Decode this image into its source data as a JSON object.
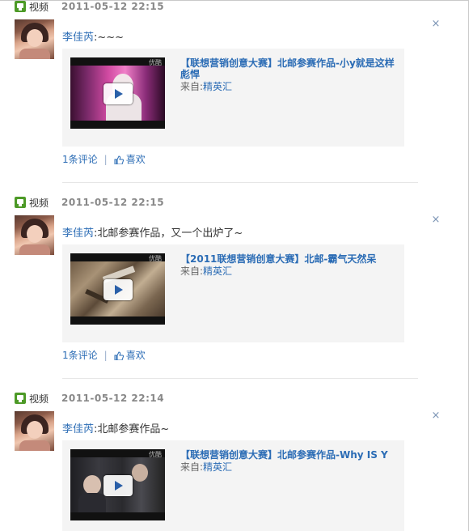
{
  "posts": [
    {
      "type_label": "视频",
      "timestamp": "2011-05-12 22:15",
      "close": "×",
      "author": "李佳芮",
      "message": ":~~~",
      "video": {
        "title": "【联想营销创意大赛】北邮参赛作品-小y就是这样彪悍",
        "source_prefix": "来自:",
        "source_name": "精英汇",
        "logo": "优酷"
      },
      "comments": "1条评论",
      "separator": "|",
      "like": "喜欢"
    },
    {
      "type_label": "视频",
      "timestamp": "2011-05-12 22:15",
      "close": "×",
      "author": "李佳芮",
      "message": ":北邮参赛作品，又一个出炉了~",
      "video": {
        "title": "【2011联想营销创意大赛】北邮-霸气天然呆",
        "source_prefix": "来自:",
        "source_name": "精英汇",
        "logo": "优酷"
      },
      "comments": "1条评论",
      "separator": "|",
      "like": "喜欢"
    },
    {
      "type_label": "视频",
      "timestamp": "2011-05-12 22:14",
      "close": "×",
      "author": "李佳芮",
      "message": ":北邮参赛作品~",
      "video": {
        "title": "【联想营销创意大赛】北邮参赛作品-Why IS Y",
        "source_prefix": "来自:",
        "source_name": "精英汇",
        "logo": "优酷"
      }
    }
  ]
}
